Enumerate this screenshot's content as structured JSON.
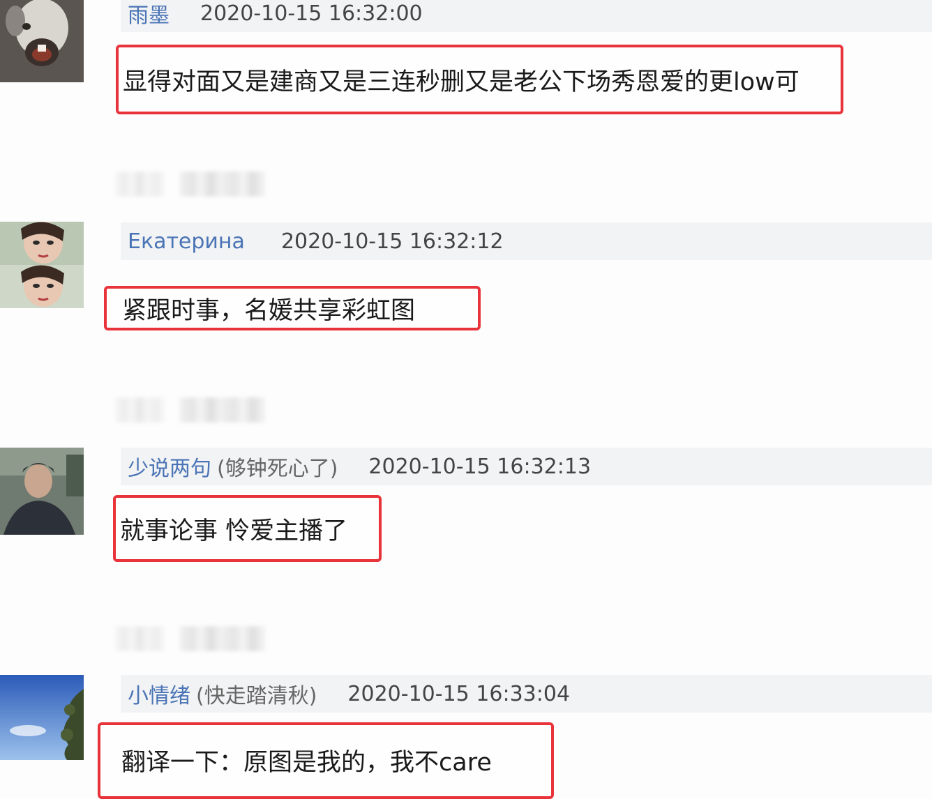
{
  "comments": [
    {
      "username": "雨墨",
      "nickname": "",
      "timestamp": "2020-10-15 16:32:00",
      "text": "显得对面又是建商又是三连秒删又是老公下场秀恩爱的更low可",
      "avatar_icon": "rabbit-avatar-icon"
    },
    {
      "username": "Екатерина",
      "nickname": "",
      "timestamp": "2020-10-15 16:32:12",
      "text": "紧跟时事，名媛共享彩虹图",
      "avatar_icon": "woman-face-avatar-icon"
    },
    {
      "username": "少说两句",
      "nickname": "(够钟死心了)",
      "timestamp": "2020-10-15 16:32:13",
      "text": "就事论事 怜爱主播了",
      "avatar_icon": "person-photo-avatar-icon"
    },
    {
      "username": "小情绪",
      "nickname": "(快走踏清秋)",
      "timestamp": "2020-10-15 16:33:04",
      "text": "翻译一下：原图是我的，我不care",
      "avatar_icon": "sky-tree-avatar-icon"
    }
  ],
  "colors": {
    "username": "#4a74b5",
    "highlight_border": "#e8333b",
    "header_bg": "#f2f3f5"
  }
}
